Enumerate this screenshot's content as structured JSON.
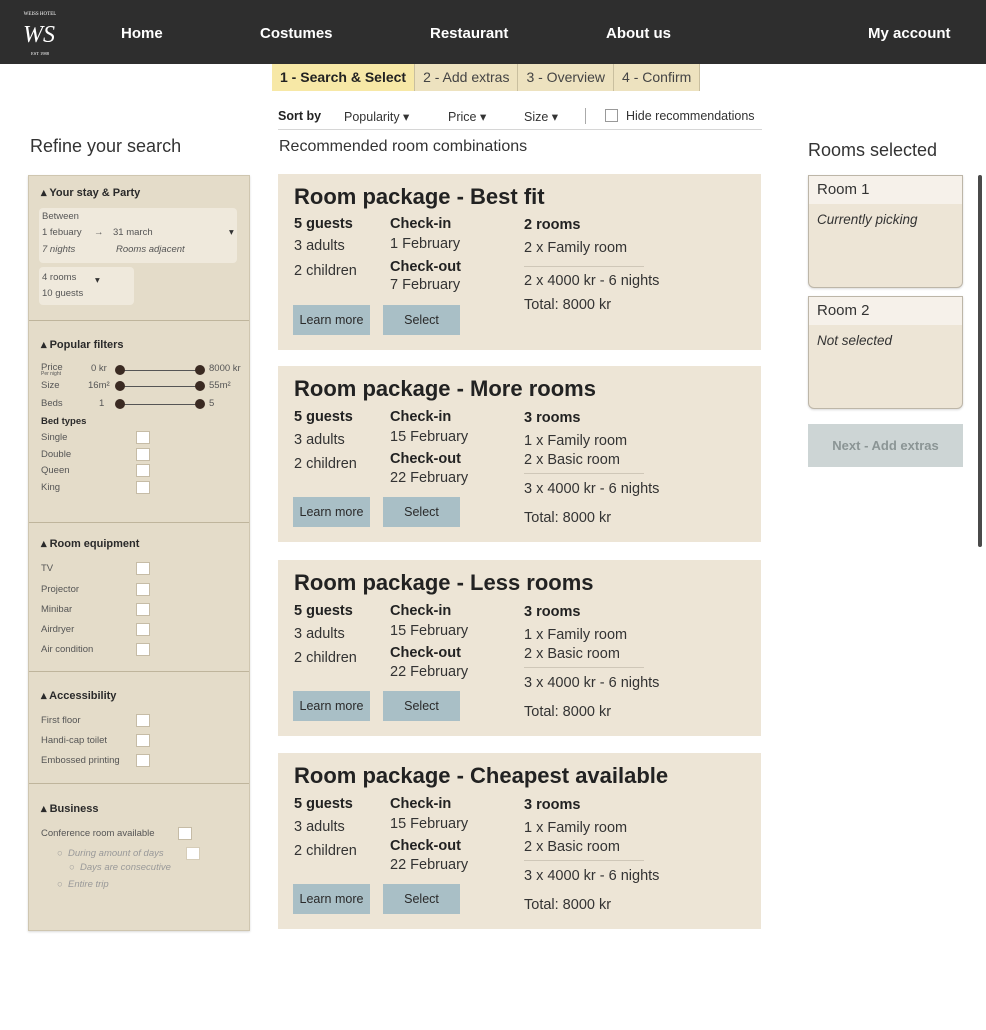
{
  "nav": {
    "logo_initials": "WS",
    "logo_top_text": "WEISS HOTEL",
    "logo_bottom_text": "EST 1988",
    "items": [
      "Home",
      "Costumes",
      "Restaurant",
      "About us"
    ],
    "account": "My account"
  },
  "steps": [
    "1 - Search & Select",
    "2 - Add extras",
    "3 - Overview",
    "4 - Confirm"
  ],
  "sort": {
    "label": "Sort by",
    "options": [
      "Popularity ▾",
      "Price ▾",
      "Size ▾"
    ],
    "hide_label": "Hide recommendations"
  },
  "refine": {
    "title": "Refine your search",
    "stay": {
      "title": "Your stay & Party",
      "between": "Between",
      "from": "1 febuary",
      "arrow": "→",
      "to": "31 march",
      "nights": "7 nights",
      "adjacent": "Rooms adjacent",
      "dropdown": "▾",
      "rooms": "4 rooms",
      "guests": "10 guests"
    },
    "popular": {
      "title": "Popular filters",
      "price_label": "Price",
      "price_sub": "Per night",
      "price_min": "0 kr",
      "price_max": "8000 kr",
      "size_label": "Size",
      "size_min": "16m²",
      "size_max": "55m²",
      "beds_label": "Beds",
      "beds_min": "1",
      "beds_max": "5",
      "bed_types_title": "Bed types",
      "bed_types": [
        "Single",
        "Double",
        "Queen",
        "King"
      ]
    },
    "equipment": {
      "title": "Room equipment",
      "items": [
        "TV",
        "Projector",
        "Minibar",
        "Airdryer",
        "Air condition"
      ]
    },
    "accessibility": {
      "title": "Accessibility",
      "items": [
        "First floor",
        "Handi-cap toilet",
        "Embossed printing"
      ]
    },
    "business": {
      "title": "Business",
      "conference": "Conference room available",
      "during": "During amount of days",
      "consecutive": "Days are consecutive",
      "entire": "Entire trip"
    }
  },
  "recommended_title": "Recommended room combinations",
  "packages": [
    {
      "title": "Room package - Best fit",
      "guests": "5 guests",
      "adults": "3 adults",
      "children": "2 children",
      "checkin_label": "Check-in",
      "checkin": "1 February",
      "checkout_label": "Check-out",
      "checkout": "7 February",
      "rooms": "2 rooms",
      "room_lines": [
        "2 x Family room"
      ],
      "price_line": "2 x 4000 kr - 6 nights",
      "total": "Total: 8000 kr",
      "learn": "Learn more",
      "select": "Select"
    },
    {
      "title": "Room package - More rooms",
      "guests": "5 guests",
      "adults": "3 adults",
      "children": "2 children",
      "checkin_label": "Check-in",
      "checkin": "15 February",
      "checkout_label": "Check-out",
      "checkout": "22 February",
      "rooms": "3 rooms",
      "room_lines": [
        "1 x Family room",
        "2 x Basic room"
      ],
      "price_line": "3 x 4000 kr - 6 nights",
      "total": "Total: 8000 kr",
      "learn": "Learn more",
      "select": "Select"
    },
    {
      "title": "Room package - Less rooms",
      "guests": "5 guests",
      "adults": "3 adults",
      "children": "2 children",
      "checkin_label": "Check-in",
      "checkin": "15 February",
      "checkout_label": "Check-out",
      "checkout": "22 February",
      "rooms": "3 rooms",
      "room_lines": [
        "1 x Family room",
        "2 x Basic room"
      ],
      "price_line": "3 x 4000 kr - 6 nights",
      "total": "Total: 8000 kr",
      "learn": "Learn more",
      "select": "Select"
    },
    {
      "title": "Room package - Cheapest available",
      "guests": "5 guests",
      "adults": "3 adults",
      "children": "2 children",
      "checkin_label": "Check-in",
      "checkin": "15 February",
      "checkout_label": "Check-out",
      "checkout": "22 February",
      "rooms": "3 rooms",
      "room_lines": [
        "1 x Family room",
        "2 x Basic room"
      ],
      "price_line": "3 x 4000 kr - 6 nights",
      "total": "Total: 8000 kr",
      "learn": "Learn more",
      "select": "Select"
    }
  ],
  "selected": {
    "title": "Rooms selected",
    "rooms": [
      {
        "name": "Room 1",
        "status": "Currently picking"
      },
      {
        "name": "Room 2",
        "status": "Not selected"
      }
    ],
    "next": "Next - Add extras"
  }
}
